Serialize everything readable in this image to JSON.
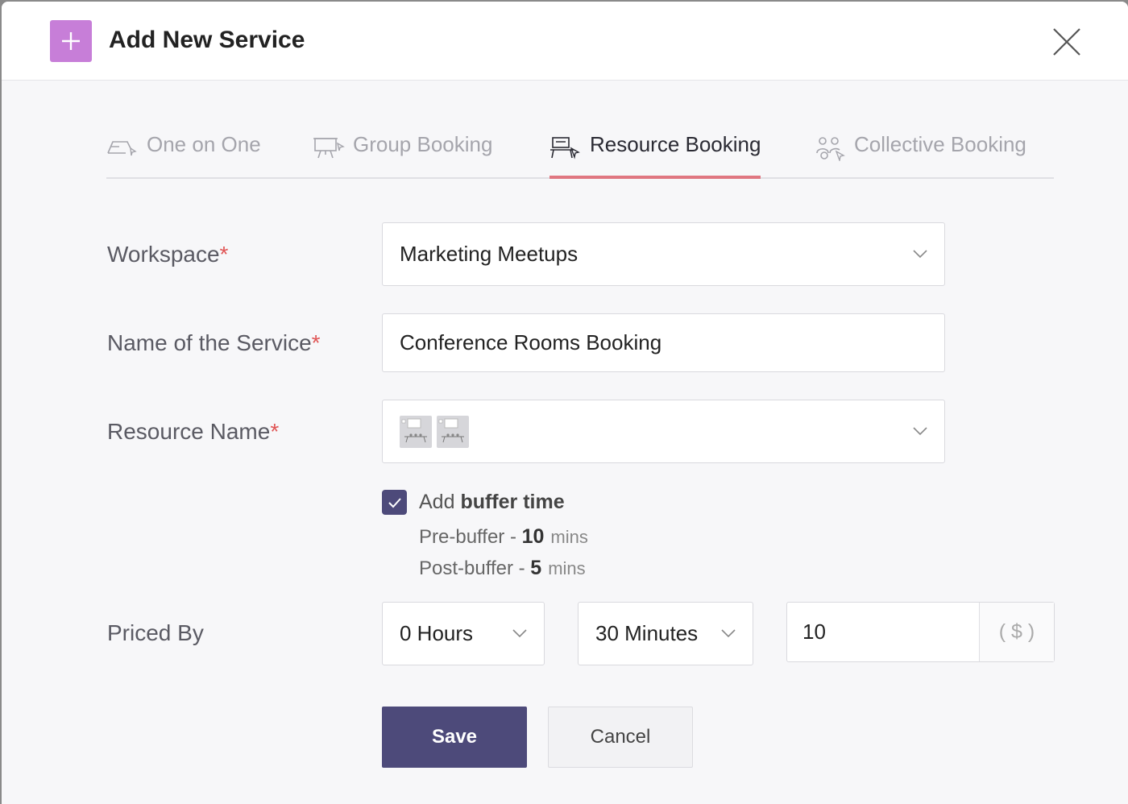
{
  "dialog": {
    "title": "Add New Service",
    "plus_icon": "plus-icon",
    "close_icon": "close-icon",
    "accent_color": "#c77ed8"
  },
  "tabs": [
    {
      "label": "One on One",
      "icon": "one-on-one-icon",
      "active": false
    },
    {
      "label": "Group Booking",
      "icon": "presentation-board-icon",
      "active": false
    },
    {
      "label": "Resource Booking",
      "icon": "resource-desk-icon",
      "active": true
    },
    {
      "label": "Collective Booking",
      "icon": "people-group-icon",
      "active": false
    }
  ],
  "form": {
    "workspace": {
      "label": "Workspace",
      "required_mark": "*",
      "value": "Marketing Meetups"
    },
    "service_name": {
      "label": "Name of the Service",
      "required_mark": "*",
      "value": "Conference Rooms Booking"
    },
    "resource_name": {
      "label": "Resource Name",
      "required_mark": "*",
      "selected_thumbnails": [
        "conference-room-thumbnail",
        "conference-room-thumbnail"
      ]
    },
    "buffer": {
      "checked": true,
      "label_prefix": "Add",
      "label_bold": "buffer time",
      "pre_label": "Pre-buffer - ",
      "pre_value": "10",
      "pre_unit": "mins",
      "post_label": "Post-buffer - ",
      "post_value": "5",
      "post_unit": "mins"
    },
    "priced_by": {
      "label": "Priced By",
      "hours": "0 Hours",
      "minutes": "30 Minutes",
      "price": "10",
      "currency": "( $ )"
    }
  },
  "actions": {
    "save": "Save",
    "cancel": "Cancel",
    "primary_color": "#4d4a7a",
    "active_tab_color": "#e07781"
  }
}
